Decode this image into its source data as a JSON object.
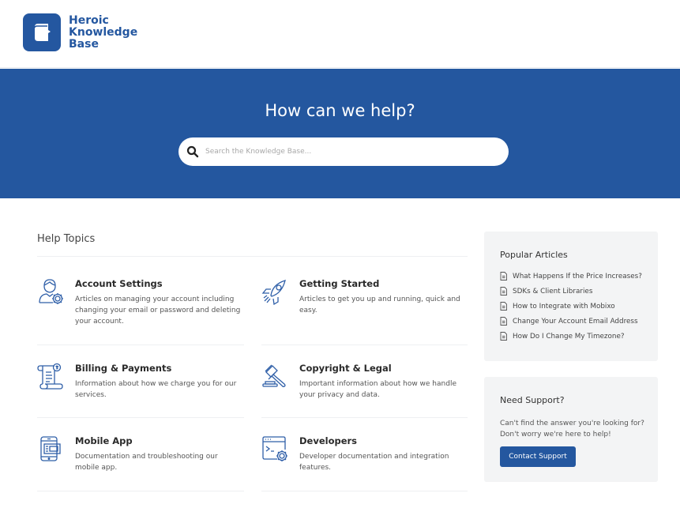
{
  "brand": {
    "name_line1": "Heroic",
    "name_line2": "Knowledge",
    "name_line3": "Base",
    "color": "#2457a0"
  },
  "hero": {
    "title": "How can we help?",
    "search_placeholder": "Search the Knowledge Base...",
    "search_value": "",
    "search_icon": "search-icon",
    "background": "#24579f"
  },
  "topics": {
    "heading": "Help Topics",
    "items": [
      {
        "title": "Account Settings",
        "description": "Articles on managing your account including changing your email or password and deleting your account.",
        "icon": "user-gear-icon"
      },
      {
        "title": "Getting Started",
        "description": "Articles to get you up and running, quick and easy.",
        "icon": "rocket-icon"
      },
      {
        "title": "Billing & Payments",
        "description": "Information about how we charge you for our services.",
        "icon": "invoice-icon"
      },
      {
        "title": "Copyright & Legal",
        "description": "Important information about how we handle your privacy and data.",
        "icon": "gavel-icon"
      },
      {
        "title": "Mobile App",
        "description": "Documentation and troubleshooting our mobile app.",
        "icon": "mobile-icon"
      },
      {
        "title": "Developers",
        "description": "Developer documentation and integration features.",
        "icon": "code-window-gear-icon"
      }
    ]
  },
  "popular": {
    "heading": "Popular Articles",
    "item_icon": "document-icon",
    "articles": [
      "What Happens If the Price Increases?",
      "SDKs & Client Libraries",
      "How to Integrate with Mobixo",
      "Change Your Account Email Address",
      "How Do I Change My Timezone?"
    ]
  },
  "support": {
    "heading": "Need Support?",
    "text": "Can't find the answer you're looking for? Don't worry we're here to help!",
    "button_label": "Contact Support"
  }
}
